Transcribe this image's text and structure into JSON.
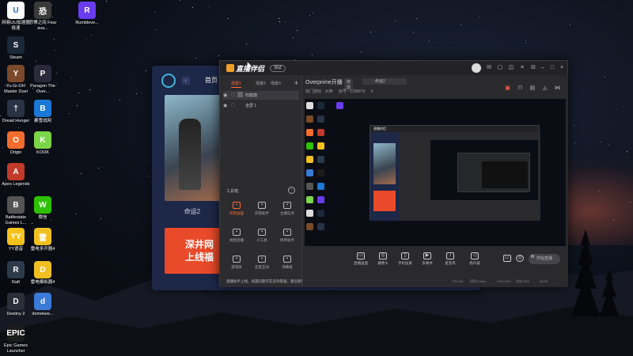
{
  "desktop": {
    "icons": [
      {
        "label": "网易UU加速器极速",
        "icon": "uu-icon",
        "color": "#ffffff",
        "glyph": "U"
      },
      {
        "label": "恐惧之间 Fear ava...",
        "icon": "game-icon",
        "color": "#3a3a3a",
        "glyph": "恐"
      },
      {
        "label": "Rumbleve...",
        "icon": "rumble-icon",
        "color": "#6a3cf0",
        "glyph": "R"
      },
      {
        "label": "Steam",
        "icon": "steam-icon",
        "color": "#1b2838",
        "glyph": "S"
      },
      {
        "label": "Yu-Gi-Oh! Master Duel",
        "icon": "yugioh-icon",
        "color": "#7a4a2a",
        "glyph": "Y"
      },
      {
        "label": "Paragon The Over...",
        "icon": "paragon-icon",
        "color": "#2a2a3a",
        "glyph": "P"
      },
      {
        "label": "Dread Hunger",
        "icon": "dread-hunger-icon",
        "color": "#2a3344",
        "glyph": "†"
      },
      {
        "label": "暴雪战网",
        "icon": "battlenet-icon",
        "color": "#1a78d6",
        "glyph": "B"
      },
      {
        "label": "Origin",
        "icon": "origin-icon",
        "color": "#f56c2d",
        "glyph": "O"
      },
      {
        "label": "KOOK",
        "icon": "kook-icon",
        "color": "#7bd64a",
        "glyph": "K"
      },
      {
        "label": "Apex Legends",
        "icon": "apex-icon",
        "color": "#c23a2a",
        "glyph": "A"
      },
      {
        "label": "Battlestate Games L...",
        "icon": "battlestate-icon",
        "color": "#555555",
        "glyph": "B"
      },
      {
        "label": "微信",
        "icon": "wechat-icon",
        "color": "#2dc100",
        "glyph": "W"
      },
      {
        "label": "YY语音",
        "icon": "yy-icon",
        "color": "#f7c21a",
        "glyph": "YY"
      },
      {
        "label": "雷电多开器4",
        "icon": "ldplayer-multi-icon",
        "color": "#f0c020",
        "glyph": "雷"
      },
      {
        "label": "Raft",
        "icon": "raft-icon",
        "color": "#2d3a4a",
        "glyph": "R"
      },
      {
        "label": "雷电模拟器4",
        "icon": "ldplayer-icon",
        "color": "#f0c020",
        "glyph": "D"
      },
      {
        "label": "Destiny 2",
        "icon": "destiny-icon",
        "color": "#2a2f3a",
        "glyph": "D"
      },
      {
        "label": "domekee...",
        "icon": "domekee-icon",
        "color": "#3b7ad6",
        "glyph": "d"
      },
      {
        "label": "Epic Games Launcher",
        "icon": "epic-icon",
        "color": "#1c1c1c",
        "glyph": "EPIC"
      }
    ]
  },
  "launcher": {
    "home_label": "首页",
    "game_name": "命运2",
    "ad_line1": "深井网",
    "ad_line2": "上线福"
  },
  "app": {
    "brand": "直播伴侣",
    "brand_badge": "测试",
    "scene": {
      "tabs": [
        "场景1",
        "场景2",
        "场景3"
      ],
      "plus": "+",
      "items": [
        "石窟炮",
        "全屏 1"
      ],
      "toolbox_title": "工具箱",
      "tools": [
        {
          "label": "场景画面",
          "icon": "scene-icon",
          "hot": true
        },
        {
          "label": "房管助手",
          "icon": "admin-icon",
          "hot": false
        },
        {
          "label": "主播任务",
          "icon": "task-icon",
          "hot": false
        },
        {
          "label": "视频连播",
          "icon": "video-icon",
          "hot": false
        },
        {
          "label": "小工具",
          "icon": "tool-icon",
          "hot": false
        },
        {
          "label": "榜单助手",
          "icon": "rank-icon",
          "hot": false
        },
        {
          "label": "游戏屏",
          "icon": "game-screen-icon",
          "hot": false
        },
        {
          "label": "连麦互动",
          "icon": "link-icon",
          "hot": false
        },
        {
          "label": "弹幕框",
          "icon": "danmaku-icon",
          "hot": false
        }
      ],
      "status_text": "直播助手上线，如遇问题可先咨询客服，建议使用专业版"
    },
    "room": {
      "title": "Overprime开播",
      "edit_label": "修改",
      "category": "命运2",
      "line2": [
        "热门游戏 · 大神",
        "房号 · 1198879",
        "0"
      ]
    },
    "bottom_tools": [
      {
        "label": "直播画面",
        "icon": "screen-icon"
      },
      {
        "label": "摄像头",
        "icon": "camera-icon"
      },
      {
        "label": "手机投屏",
        "icon": "phone-icon"
      },
      {
        "label": "多媒体",
        "icon": "media-icon"
      },
      {
        "label": "麦克风",
        "icon": "mic-icon"
      },
      {
        "label": "扬声器",
        "icon": "speaker-icon"
      }
    ],
    "start_label": "开始直播",
    "status_items": [
      "FPS:60",
      "码率:0 kb/s",
      "CPU:12%",
      "内存:51%",
      "00:00"
    ]
  }
}
